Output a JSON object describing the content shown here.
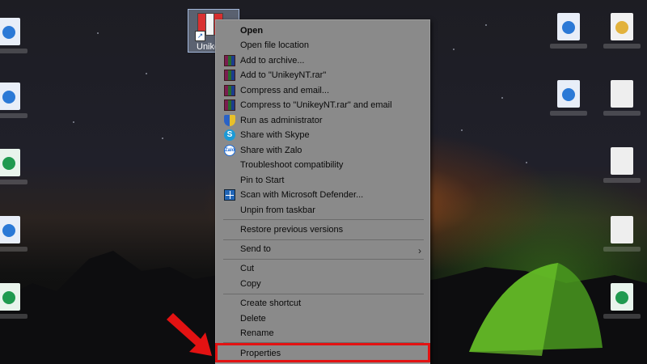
{
  "desktop": {
    "selected_icon_label": "Unikey"
  },
  "context_menu": {
    "items": [
      {
        "label": "Open",
        "bold": true
      },
      {
        "label": "Open file location"
      },
      {
        "label": "Add to archive...",
        "icon": "winrar-icon"
      },
      {
        "label": "Add to \"UnikeyNT.rar\"",
        "icon": "winrar-icon"
      },
      {
        "label": "Compress and email...",
        "icon": "winrar-icon"
      },
      {
        "label": "Compress to \"UnikeyNT.rar\" and email",
        "icon": "winrar-icon"
      },
      {
        "label": "Run as administrator",
        "icon": "uac-shield-icon"
      },
      {
        "label": "Share with Skype",
        "icon": "skype-icon"
      },
      {
        "label": "Share with Zalo",
        "icon": "zalo-icon",
        "icon_text": "Zalo"
      },
      {
        "label": "Troubleshoot compatibility"
      },
      {
        "label": "Pin to Start"
      },
      {
        "label": "Scan with Microsoft Defender...",
        "icon": "defender-icon"
      },
      {
        "label": "Unpin from taskbar"
      },
      {
        "label": "Restore previous versions"
      },
      {
        "label": "Send to",
        "submenu": true
      },
      {
        "label": "Cut"
      },
      {
        "label": "Copy"
      },
      {
        "label": "Create shortcut"
      },
      {
        "label": "Delete"
      },
      {
        "label": "Rename"
      },
      {
        "label": "Properties",
        "highlighted": true
      }
    ]
  },
  "colors": {
    "menu_background": "#8a8a8a",
    "highlight_border": "#e31212",
    "annotation_arrow": "#e31212"
  }
}
